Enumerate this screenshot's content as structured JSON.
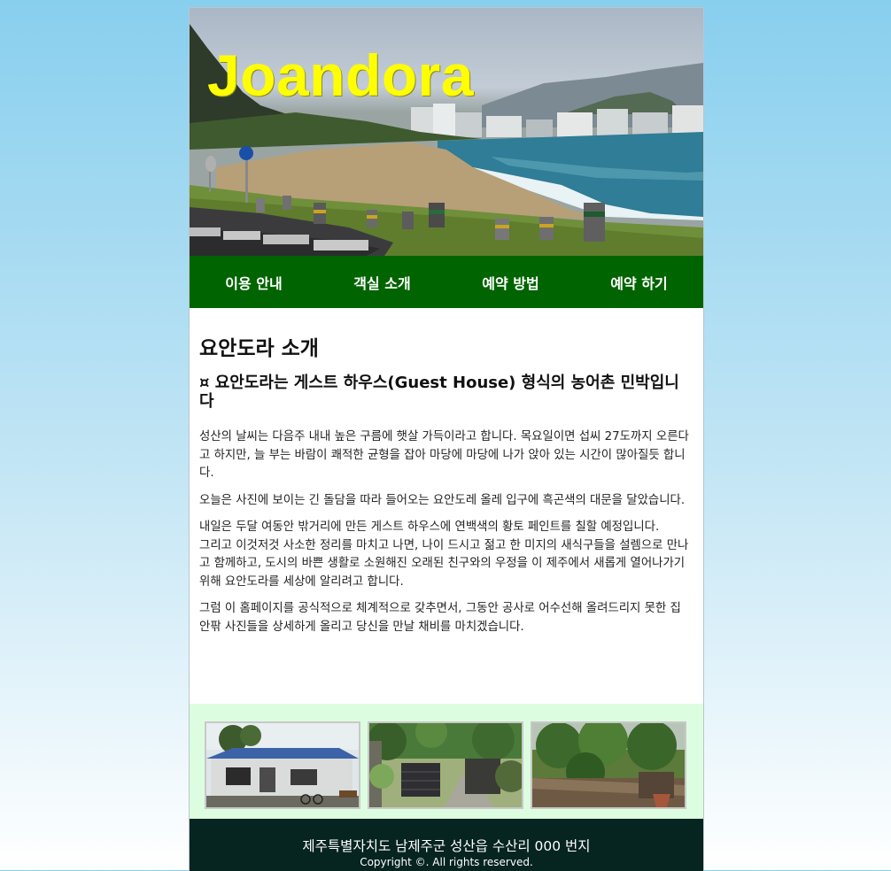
{
  "header": {
    "brand": "Joandora"
  },
  "nav": {
    "items": [
      {
        "label": "이용 안내"
      },
      {
        "label": "객실 소개"
      },
      {
        "label": "예약 방법"
      },
      {
        "label": "예약 하기"
      }
    ]
  },
  "main": {
    "title": "요안도라 소개",
    "subtitle": "¤ 요안도라는 게스트 하우스(Guest House) 형식의 농어촌 민박입니다",
    "paragraphs": [
      "성산의 날씨는 다음주 내내 높은 구름에 햇살 가득이라고 합니다. 목요일이면 섭씨 27도까지 오른다고 하지만, 늘 부는 바람이 쾌적한 균형을 잡아 마당에 마당에 나가 앉아 있는 시간이 많아질듯 합니다.",
      "오늘은 사진에 보이는 긴 돌담을 따라 들어오는 요안도레 올레 입구에 흑곤색의 대문을 달았습니다.",
      "내일은 두달 여동안 밖거리에 만든 게스트 하우스에 연백색의 황토 페인트를 칠할 예정입니다.",
      "그리고 이것저것 사소한 정리를 마치고 나면, 나이 드시고 젊고 한 미지의 새식구들을 설렘으로 만나고 함께하고, 도시의 바쁜 생활로 소원해진 오래된 친구와의 우정을 이 제주에서 새롭게 열어나가기 위해 요안도라를 세상에 알리려고 합니다.",
      "그럼 이 홈페이지를 공식적으로 체계적으로 갖추면서, 그동안 공사로 어수선해 올려드리지 못한 집 안팎 사진들을 상세하게 올리고 당신을 만날 채비를 마치겠습니다."
    ]
  },
  "footer": {
    "address": "제주특별자치도 남제주군 성산읍 수산리 000 번지",
    "copyright": "Copyright ©. All rights reserved."
  }
}
